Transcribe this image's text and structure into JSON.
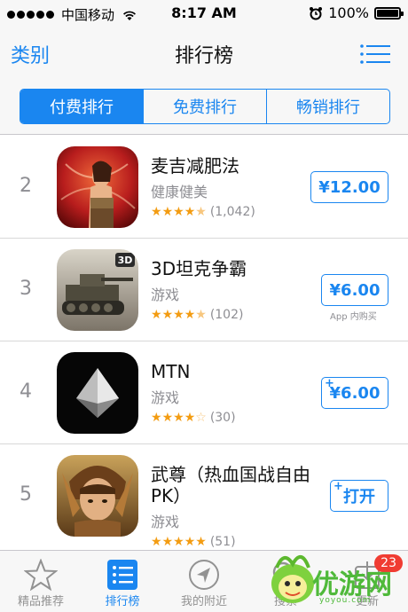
{
  "status_bar": {
    "carrier": "中国移动",
    "time": "8:17 AM",
    "battery": "100%"
  },
  "nav": {
    "left": "类别",
    "title": "排行榜",
    "right_icon": "list-icon"
  },
  "segments": [
    {
      "label": "付费排行",
      "active": true
    },
    {
      "label": "免费排行",
      "active": false
    },
    {
      "label": "畅销排行",
      "active": false
    }
  ],
  "apps": [
    {
      "rank": "2",
      "name": "麦吉减肥法",
      "category": "健康健美",
      "rating": 4.5,
      "count": "(1,042)",
      "price": "¥12.00",
      "in_app": "",
      "plus": false
    },
    {
      "rank": "3",
      "name": "3D坦克争霸",
      "category": "游戏",
      "rating": 4.5,
      "count": "(102)",
      "price": "¥6.00",
      "in_app": "App 内购买",
      "plus": false
    },
    {
      "rank": "4",
      "name": "MTN",
      "category": "游戏",
      "rating": 4,
      "count": "(30)",
      "price": "¥6.00",
      "in_app": "",
      "plus": true
    },
    {
      "rank": "5",
      "name": "武尊（热血国战自由PK）",
      "category": "游戏",
      "rating": 5,
      "count": "(51)",
      "price": "打开",
      "in_app": "",
      "plus": true
    }
  ],
  "tabbar": [
    {
      "label": "精品推荐",
      "icon": "star-icon",
      "active": false
    },
    {
      "label": "排行榜",
      "icon": "ranking-list-icon",
      "active": true
    },
    {
      "label": "我的附近",
      "icon": "location-arrow-icon",
      "active": false
    },
    {
      "label": "搜索",
      "icon": "search-icon",
      "active": false
    },
    {
      "label": "更新",
      "icon": "updates-icon",
      "active": false,
      "badge": "23"
    }
  ],
  "watermark": {
    "text": "优游网",
    "sub": "yoyou.com"
  },
  "colors": {
    "accent": "#1a86f0",
    "star": "#f39c12",
    "badge": "#f03c32",
    "watermark": "#4fb93a"
  }
}
